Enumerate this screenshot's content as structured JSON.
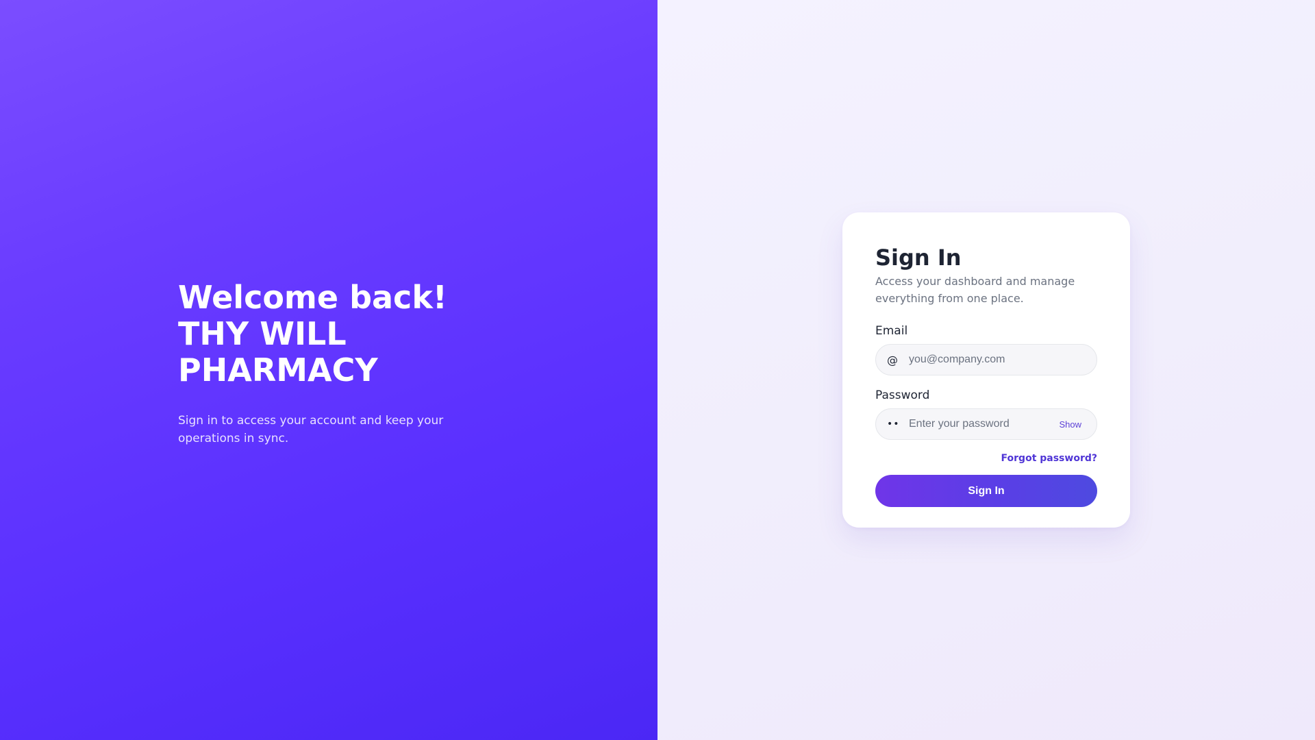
{
  "hero": {
    "title_lines": [
      "Welcome back!",
      "THY WILL",
      "PHARMACY"
    ],
    "subtitle": "Sign in to access your account and keep your operations in sync."
  },
  "login": {
    "title": "Sign In",
    "subtitle": "Access your dashboard and manage everything from one place.",
    "email": {
      "label": "Email",
      "icon": "at-icon",
      "icon_glyph": "@",
      "value": "",
      "placeholder": "you@company.com"
    },
    "password": {
      "label": "Password",
      "icon": "password-dots-icon",
      "icon_glyph": "••",
      "value": "",
      "placeholder": "Enter your password",
      "toggle_label": "Show"
    },
    "forgot_label": "Forgot password?",
    "submit_label": "Sign In"
  },
  "colors": {
    "accent": "#5b3fd6",
    "left_gradient_start": "#7b4dff",
    "left_gradient_end": "#4b27f5",
    "button_gradient_start": "#6f35e8",
    "button_gradient_end": "#4e4ae0"
  }
}
